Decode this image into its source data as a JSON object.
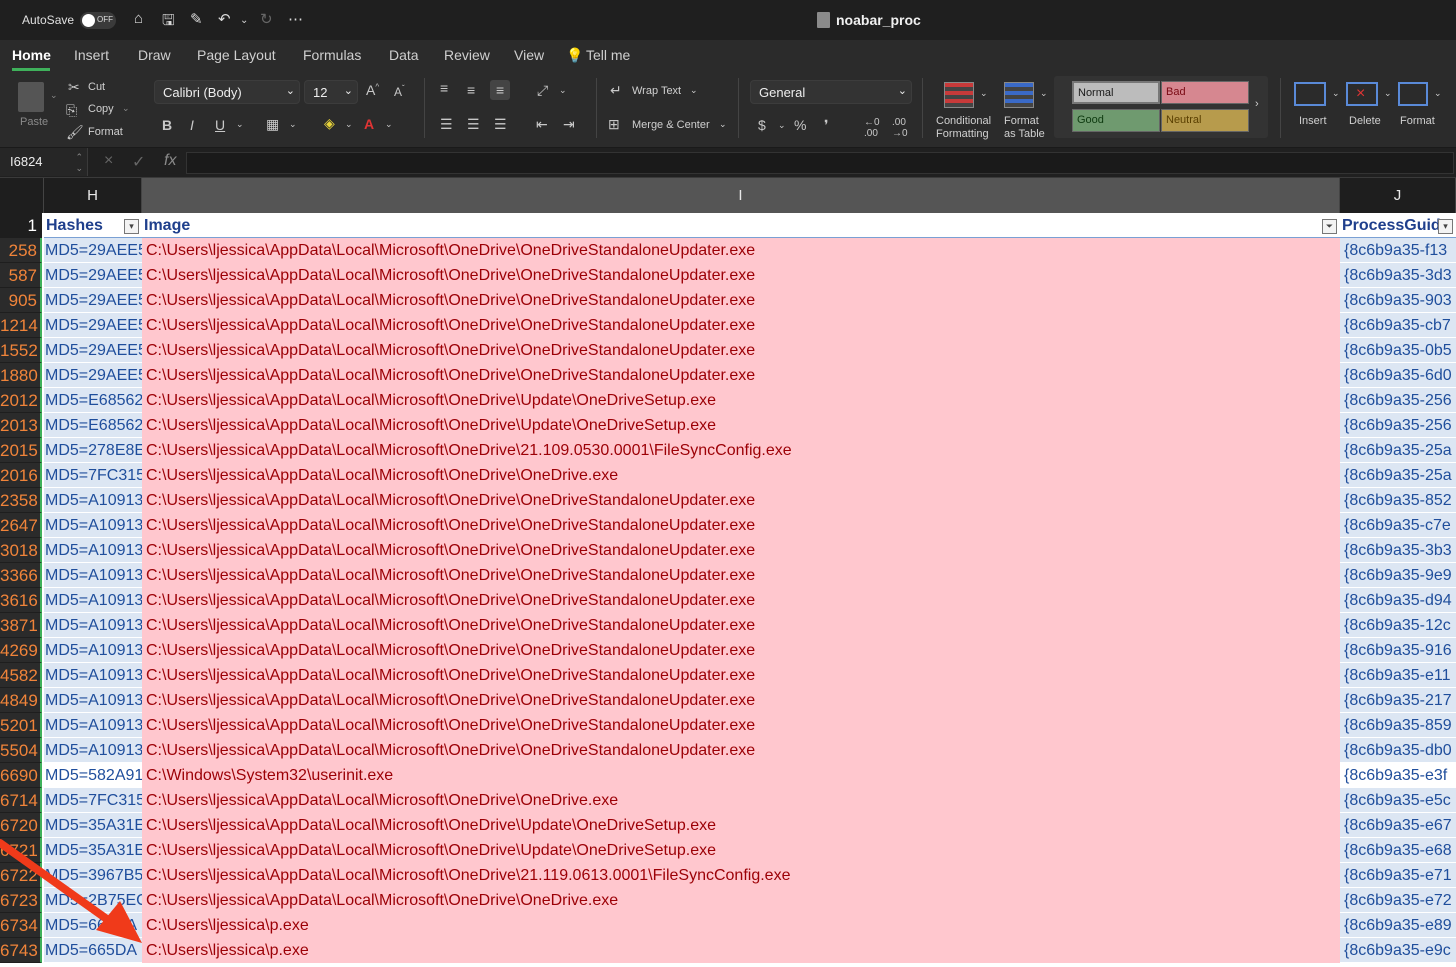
{
  "titlebar": {
    "autosave_label": "AutoSave",
    "autosave_state": "OFF",
    "document_title": "noabar_proc"
  },
  "tabs": [
    "Home",
    "Insert",
    "Draw",
    "Page Layout",
    "Formulas",
    "Data",
    "Review",
    "View",
    "Tell me"
  ],
  "active_tab": "Home",
  "ribbon": {
    "paste": "Paste",
    "cut": "Cut",
    "copy": "Copy",
    "format": "Format",
    "font_name": "Calibri (Body)",
    "font_size": "12",
    "wrap_text": "Wrap Text",
    "merge_center": "Merge & Center",
    "number_format": "General",
    "conditional_formatting": "Conditional\nFormatting",
    "format_as_table": "Format\nas Table",
    "styles": {
      "normal": "Normal",
      "bad": "Bad",
      "good": "Good",
      "neutral": "Neutral"
    },
    "insert": "Insert",
    "delete": "Delete",
    "format_cells": "Format"
  },
  "formula_bar": {
    "name_box": "I6824",
    "fx": "fx",
    "value": ""
  },
  "columns": {
    "H": "H",
    "I": "I",
    "J": "J"
  },
  "header_row": {
    "number": "1",
    "hashes": "Hashes",
    "image": "Image",
    "process_guid": "ProcessGuid"
  },
  "rows": [
    {
      "n": "258",
      "hash": "MD5=29AEE5",
      "image": "C:\\Users\\ljessica\\AppData\\Local\\Microsoft\\OneDrive\\OneDriveStandaloneUpdater.exe",
      "guid": "{8c6b9a35-f13"
    },
    {
      "n": "587",
      "hash": "MD5=29AEE5",
      "image": "C:\\Users\\ljessica\\AppData\\Local\\Microsoft\\OneDrive\\OneDriveStandaloneUpdater.exe",
      "guid": "{8c6b9a35-3d3"
    },
    {
      "n": "905",
      "hash": "MD5=29AEE5",
      "image": "C:\\Users\\ljessica\\AppData\\Local\\Microsoft\\OneDrive\\OneDriveStandaloneUpdater.exe",
      "guid": "{8c6b9a35-903"
    },
    {
      "n": "1214",
      "hash": "MD5=29AEE5",
      "image": "C:\\Users\\ljessica\\AppData\\Local\\Microsoft\\OneDrive\\OneDriveStandaloneUpdater.exe",
      "guid": "{8c6b9a35-cb7"
    },
    {
      "n": "1552",
      "hash": "MD5=29AEE5",
      "image": "C:\\Users\\ljessica\\AppData\\Local\\Microsoft\\OneDrive\\OneDriveStandaloneUpdater.exe",
      "guid": "{8c6b9a35-0b5"
    },
    {
      "n": "1880",
      "hash": "MD5=29AEE5",
      "image": "C:\\Users\\ljessica\\AppData\\Local\\Microsoft\\OneDrive\\OneDriveStandaloneUpdater.exe",
      "guid": "{8c6b9a35-6d0"
    },
    {
      "n": "2012",
      "hash": "MD5=E68562",
      "image": "C:\\Users\\ljessica\\AppData\\Local\\Microsoft\\OneDrive\\Update\\OneDriveSetup.exe",
      "guid": "{8c6b9a35-256"
    },
    {
      "n": "2013",
      "hash": "MD5=E68562",
      "image": "C:\\Users\\ljessica\\AppData\\Local\\Microsoft\\OneDrive\\Update\\OneDriveSetup.exe",
      "guid": "{8c6b9a35-256"
    },
    {
      "n": "2015",
      "hash": "MD5=278E8E",
      "image": "C:\\Users\\ljessica\\AppData\\Local\\Microsoft\\OneDrive\\21.109.0530.0001\\FileSyncConfig.exe",
      "guid": "{8c6b9a35-25a"
    },
    {
      "n": "2016",
      "hash": "MD5=7FC315",
      "image": "C:\\Users\\ljessica\\AppData\\Local\\Microsoft\\OneDrive\\OneDrive.exe",
      "guid": "{8c6b9a35-25a"
    },
    {
      "n": "2358",
      "hash": "MD5=A10913",
      "image": "C:\\Users\\ljessica\\AppData\\Local\\Microsoft\\OneDrive\\OneDriveStandaloneUpdater.exe",
      "guid": "{8c6b9a35-852"
    },
    {
      "n": "2647",
      "hash": "MD5=A10913",
      "image": "C:\\Users\\ljessica\\AppData\\Local\\Microsoft\\OneDrive\\OneDriveStandaloneUpdater.exe",
      "guid": "{8c6b9a35-c7e"
    },
    {
      "n": "3018",
      "hash": "MD5=A10913",
      "image": "C:\\Users\\ljessica\\AppData\\Local\\Microsoft\\OneDrive\\OneDriveStandaloneUpdater.exe",
      "guid": "{8c6b9a35-3b3"
    },
    {
      "n": "3366",
      "hash": "MD5=A10913",
      "image": "C:\\Users\\ljessica\\AppData\\Local\\Microsoft\\OneDrive\\OneDriveStandaloneUpdater.exe",
      "guid": "{8c6b9a35-9e9"
    },
    {
      "n": "3616",
      "hash": "MD5=A10913",
      "image": "C:\\Users\\ljessica\\AppData\\Local\\Microsoft\\OneDrive\\OneDriveStandaloneUpdater.exe",
      "guid": "{8c6b9a35-d94"
    },
    {
      "n": "3871",
      "hash": "MD5=A10913",
      "image": "C:\\Users\\ljessica\\AppData\\Local\\Microsoft\\OneDrive\\OneDriveStandaloneUpdater.exe",
      "guid": "{8c6b9a35-12c"
    },
    {
      "n": "4269",
      "hash": "MD5=A10913",
      "image": "C:\\Users\\ljessica\\AppData\\Local\\Microsoft\\OneDrive\\OneDriveStandaloneUpdater.exe",
      "guid": "{8c6b9a35-916"
    },
    {
      "n": "4582",
      "hash": "MD5=A10913",
      "image": "C:\\Users\\ljessica\\AppData\\Local\\Microsoft\\OneDrive\\OneDriveStandaloneUpdater.exe",
      "guid": "{8c6b9a35-e11"
    },
    {
      "n": "4849",
      "hash": "MD5=A10913",
      "image": "C:\\Users\\ljessica\\AppData\\Local\\Microsoft\\OneDrive\\OneDriveStandaloneUpdater.exe",
      "guid": "{8c6b9a35-217"
    },
    {
      "n": "5201",
      "hash": "MD5=A10913",
      "image": "C:\\Users\\ljessica\\AppData\\Local\\Microsoft\\OneDrive\\OneDriveStandaloneUpdater.exe",
      "guid": "{8c6b9a35-859"
    },
    {
      "n": "5504",
      "hash": "MD5=A10913",
      "image": "C:\\Users\\ljessica\\AppData\\Local\\Microsoft\\OneDrive\\OneDriveStandaloneUpdater.exe",
      "guid": "{8c6b9a35-db0"
    },
    {
      "n": "6690",
      "hash": "MD5=582A91",
      "image": "C:\\Windows\\System32\\userinit.exe",
      "guid": "{8c6b9a35-e3f"
    },
    {
      "n": "6714",
      "hash": "MD5=7FC315",
      "image": "C:\\Users\\ljessica\\AppData\\Local\\Microsoft\\OneDrive\\OneDrive.exe",
      "guid": "{8c6b9a35-e5c"
    },
    {
      "n": "6720",
      "hash": "MD5=35A31E",
      "image": "C:\\Users\\ljessica\\AppData\\Local\\Microsoft\\OneDrive\\Update\\OneDriveSetup.exe",
      "guid": "{8c6b9a35-e67"
    },
    {
      "n": "6721",
      "hash": "MD5=35A31E",
      "image": "C:\\Users\\ljessica\\AppData\\Local\\Microsoft\\OneDrive\\Update\\OneDriveSetup.exe",
      "guid": "{8c6b9a35-e68"
    },
    {
      "n": "6722",
      "hash": "MD5=3967B5",
      "image": "C:\\Users\\ljessica\\AppData\\Local\\Microsoft\\OneDrive\\21.119.0613.0001\\FileSyncConfig.exe",
      "guid": "{8c6b9a35-e71"
    },
    {
      "n": "6723",
      "hash": "MD5=2B75EC",
      "image": "C:\\Users\\ljessica\\AppData\\Local\\Microsoft\\OneDrive\\OneDrive.exe",
      "guid": "{8c6b9a35-e72"
    },
    {
      "n": "6734",
      "hash": "MD5=665DA",
      "image": "C:\\Users\\ljessica\\p.exe",
      "guid": "{8c6b9a35-e89"
    },
    {
      "n": "6743",
      "hash": "MD5=665DA",
      "image": "C:\\Users\\ljessica\\p.exe",
      "guid": "{8c6b9a35-e9c"
    }
  ],
  "colors": {
    "accent_green": "#3fb15b",
    "row_number_orange": "#f0843a",
    "bad_fill": "#ffc7ce",
    "bad_text": "#9c0006",
    "annotation_arrow": "#f03a1a"
  }
}
